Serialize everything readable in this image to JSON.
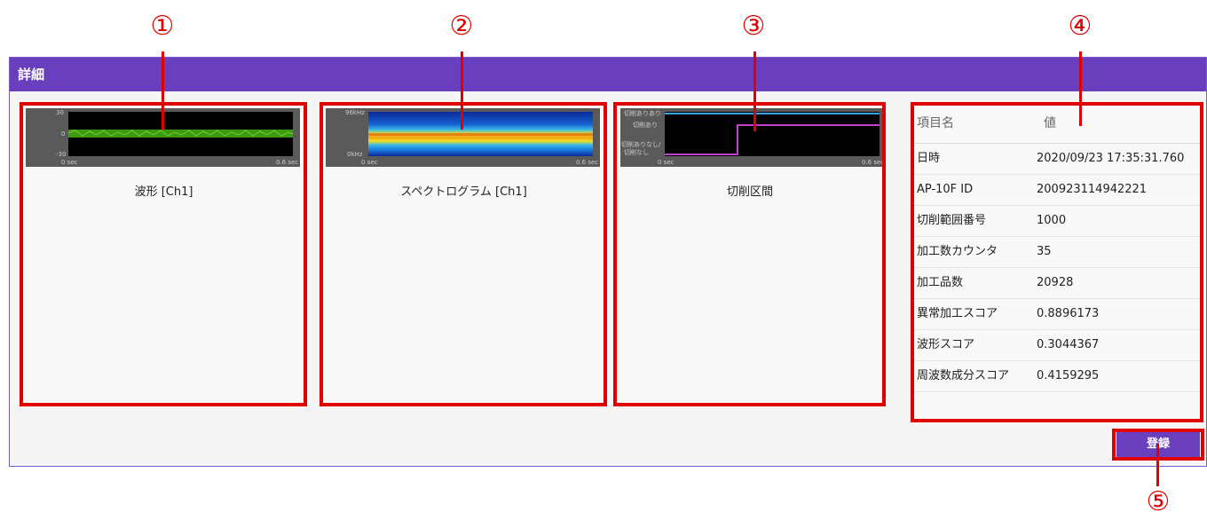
{
  "annotations": {
    "n1": "①",
    "n2": "②",
    "n3": "③",
    "n4": "④",
    "n5": "⑤"
  },
  "panel": {
    "title": "詳細"
  },
  "cards": {
    "waveform": {
      "label": "波形 [Ch1]",
      "y_top": "30",
      "y_mid": "0",
      "y_bottom": "-30",
      "x_start": "0 sec",
      "x_end": "0.6 sec"
    },
    "spectrogram": {
      "label": "スペクトログラム [Ch1]",
      "y_top": "96kHz",
      "y_bottom": "0kHz",
      "x_start": "0 sec",
      "x_end": "0.6 sec"
    },
    "cutting": {
      "label": "切削区間",
      "y_top": "切削ありあり",
      "y_mid": "切削あり",
      "y_low1": "切削ありなし/",
      "y_low2": "切削なし",
      "x_start": "0 sec",
      "x_end": "0.6 sec"
    }
  },
  "info": {
    "header": {
      "name": "項目名",
      "value": "値"
    },
    "rows": [
      {
        "name": "日時",
        "value": "2020/09/23 17:35:31.760"
      },
      {
        "name": "AP-10F ID",
        "value": "200923114942221"
      },
      {
        "name": "切削範囲番号",
        "value": "1000"
      },
      {
        "name": "加工数カウンタ",
        "value": "35"
      },
      {
        "name": "加工品数",
        "value": "20928"
      },
      {
        "name": "異常加工スコア",
        "value": "0.8896173"
      },
      {
        "name": "波形スコア",
        "value": "0.3044367"
      },
      {
        "name": "周波数成分スコア",
        "value": "0.4159295"
      }
    ]
  },
  "actions": {
    "register": "登録"
  },
  "colors": {
    "accent": "#6a3fbd",
    "annotation": "#e00000"
  }
}
